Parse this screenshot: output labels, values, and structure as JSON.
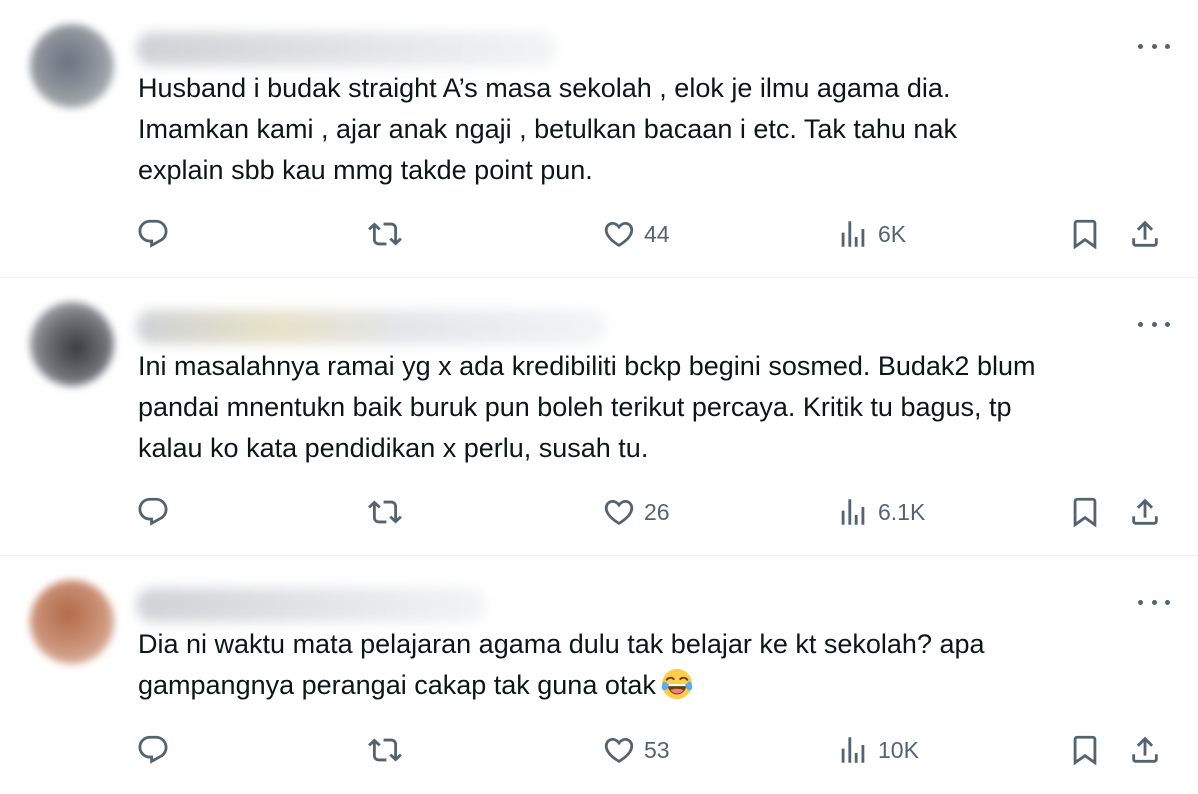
{
  "replies": [
    {
      "text_lines": [
        "Husband i budak straight A’s masa sekolah , elok je ilmu agama dia.",
        "Imamkan kami , ajar anak ngaji , betulkan bacaan i etc. Tak tahu nak",
        "explain sbb kau mmg takde point pun."
      ],
      "likes": "44",
      "views": "6K",
      "avatar_color": "#8d939b"
    },
    {
      "text_lines": [
        "Ini masalahnya ramai yg x ada kredibiliti bckp begini sosmed. Budak2 blum",
        "pandai mnentukn baik buruk pun boleh terikut percaya. Kritik tu bagus, tp",
        "kalau ko kata pendidikan x perlu, susah tu."
      ],
      "likes": "26",
      "views": "6.1K",
      "avatar_color": "#6d7076"
    },
    {
      "text_lines": [
        "Dia ni waktu mata pelajaran agama dulu tak belajar ke kt sekolah? apa",
        "gampangnya perangai cakap tak guna otak"
      ],
      "emoji": "face-with-tears-of-joy",
      "likes": "53",
      "views": "10K",
      "avatar_color": "#c98d72"
    }
  ],
  "icons": {
    "reply": "reply-icon",
    "retweet": "retweet-icon",
    "like": "heart-icon",
    "views": "views-icon",
    "bookmark": "bookmark-icon",
    "share": "share-icon",
    "more": "more-icon"
  },
  "colors": {
    "text": "#0f1419",
    "secondary": "#536471",
    "divider": "#eff3f4"
  }
}
